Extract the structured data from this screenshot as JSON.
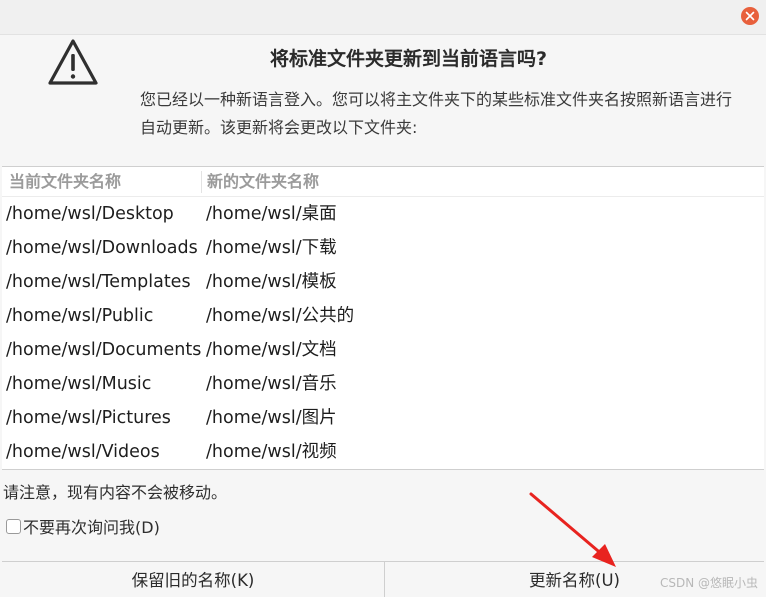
{
  "dialog": {
    "title": "将标准文件夹更新到当前语言吗?",
    "description": "您已经以一种新语言登入。您可以将主文件夹下的某些标准文件夹名按照新语言进行自动更新。该更新将会更改以下文件夹:",
    "icon": "warning-icon",
    "close_icon": "close-icon"
  },
  "table": {
    "headers": [
      "当前文件夹名称",
      "新的文件夹名称"
    ],
    "rows": [
      [
        "/home/wsl/Desktop",
        "/home/wsl/桌面"
      ],
      [
        "/home/wsl/Downloads",
        "/home/wsl/下载"
      ],
      [
        "/home/wsl/Templates",
        "/home/wsl/模板"
      ],
      [
        "/home/wsl/Public",
        "/home/wsl/公共的"
      ],
      [
        "/home/wsl/Documents",
        "/home/wsl/文档"
      ],
      [
        "/home/wsl/Music",
        "/home/wsl/音乐"
      ],
      [
        "/home/wsl/Pictures",
        "/home/wsl/图片"
      ],
      [
        "/home/wsl/Videos",
        "/home/wsl/视频"
      ]
    ]
  },
  "note": "请注意，现有内容不会被移动。",
  "checkbox": {
    "label": "不要再次询问我(D)",
    "checked": false
  },
  "buttons": {
    "keep": "保留旧的名称(K)",
    "update": "更新名称(U)"
  },
  "watermark": "CSDN @悠眠小虫",
  "colors": {
    "close_button": "#e8603c",
    "annotation_arrow": "#e8231f"
  }
}
